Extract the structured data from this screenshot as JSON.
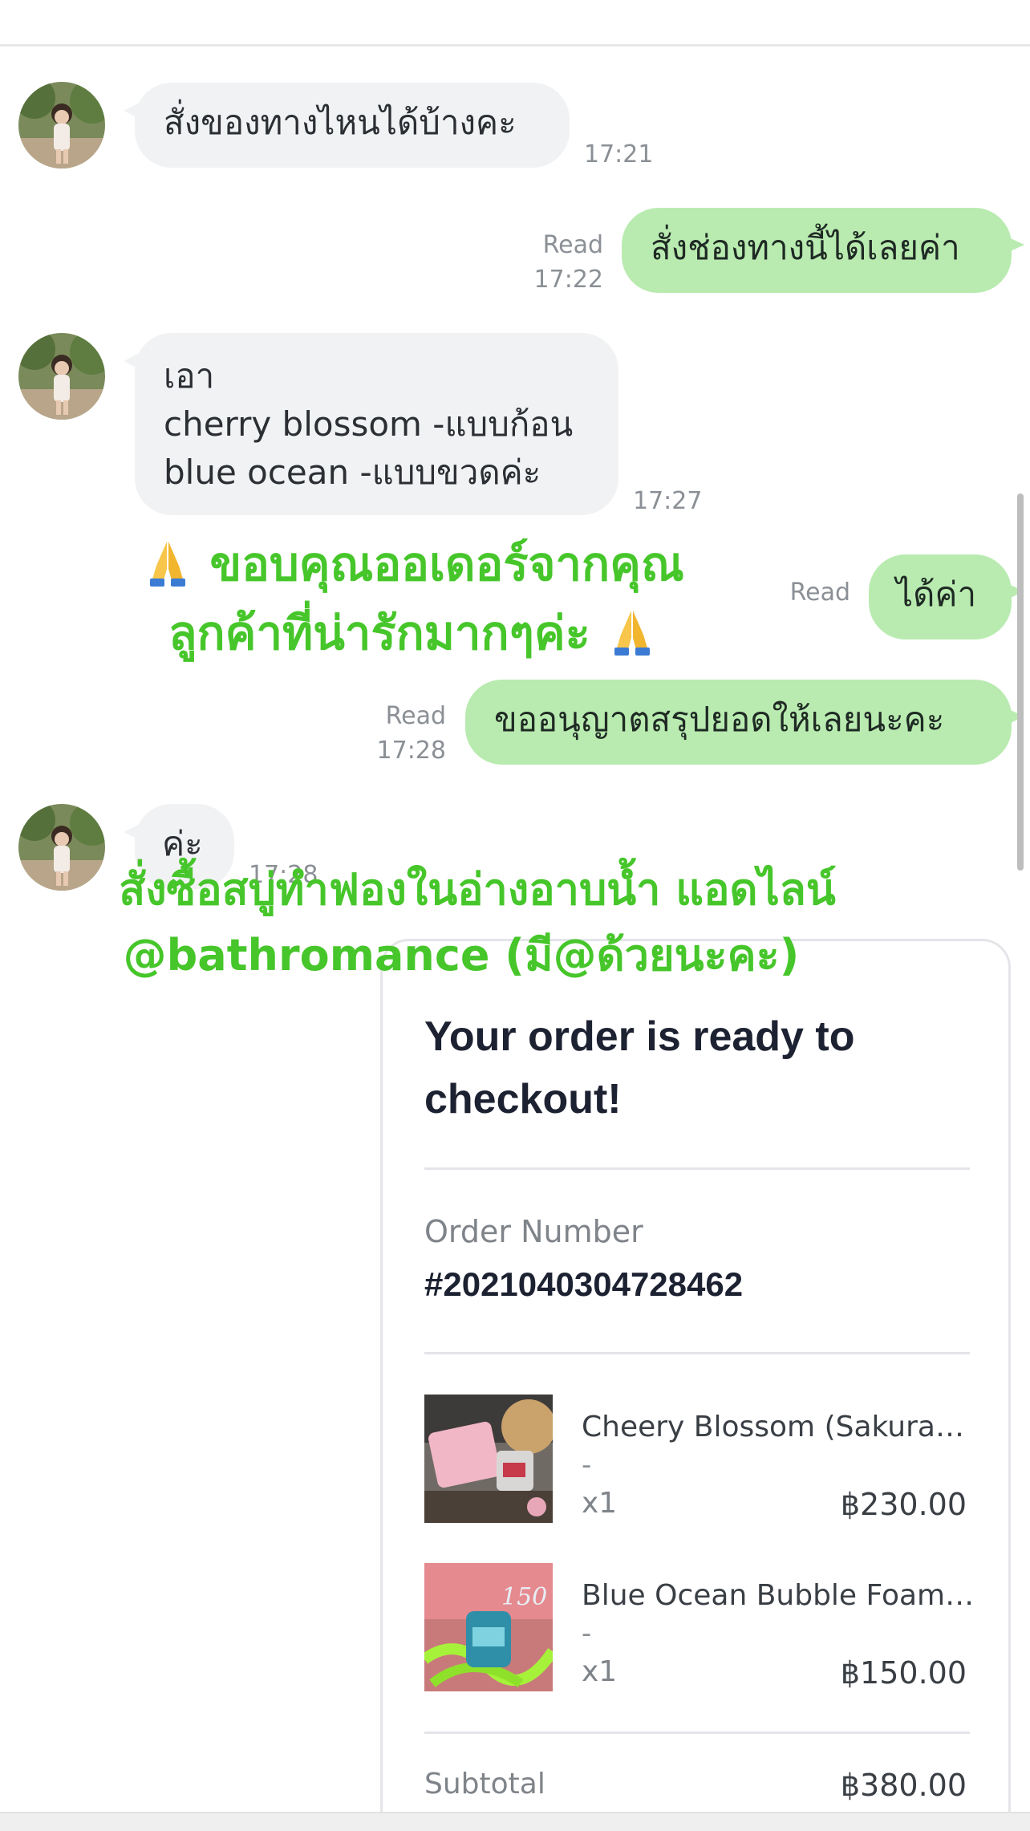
{
  "messages": [
    {
      "id": "m1",
      "direction": "in",
      "text": "สั่งของทางไหนได้บ้างคะ",
      "time": "17:21"
    },
    {
      "id": "m2",
      "direction": "out",
      "text": "สั่งช่องทางนี้ได้เลยค่า",
      "read": "Read",
      "time": "17:22"
    },
    {
      "id": "m3",
      "direction": "in",
      "text": "เอา\ncherry blossom -แบบก้อน\nblue ocean -แบบขวดค่ะ",
      "time": "17:27"
    },
    {
      "id": "m4",
      "direction": "out",
      "text": "ได้ค่า",
      "read": "Read"
    },
    {
      "id": "m5",
      "direction": "out",
      "text": "ขออนุญาตสรุปยอดให้เลยนะคะ",
      "read": "Read",
      "time": "17:28"
    },
    {
      "id": "m6",
      "direction": "in",
      "text": "ค่ะ",
      "time": "17:28"
    }
  ],
  "overlays": {
    "thanks_line1": "ขอบคุณออเดอร์จากคุณ",
    "thanks_line2": "ลูกค้าที่น่ารักมากๆค่ะ",
    "promo_line1": "สั่งซื้อสบู่ทำฟองในอ่างอาบน้ำ แอดไลน์",
    "promo_line2": "@bathromance (มี@ด้วยนะคะ)",
    "emoji": "praying-hands-icon"
  },
  "order_card": {
    "title": "Your order is ready to checkout!",
    "order_number_label": "Order Number",
    "order_number": "#2021040304728462",
    "items": [
      {
        "name": "Cheery Blossom (Sakura) ...",
        "variant": "-",
        "qty": "x1",
        "price": "฿230.00"
      },
      {
        "name": "Blue Ocean Bubble Foam ...",
        "variant": "-",
        "qty": "x1",
        "price": "฿150.00"
      }
    ],
    "subtotal_label": "Subtotal",
    "subtotal": "฿380.00"
  },
  "colors": {
    "outgoing_bubble": "#b9ebb0",
    "incoming_bubble": "#f1f2f4",
    "overlay_green": "#46c62a",
    "title_navy": "#1d2232"
  }
}
